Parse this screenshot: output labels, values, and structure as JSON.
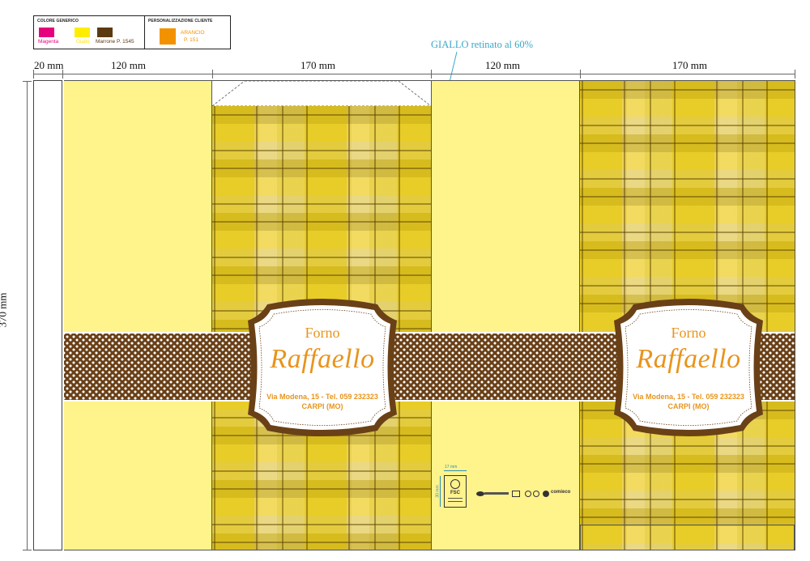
{
  "legend": {
    "generic_title": "COLORE GENERICO",
    "custom_title": "PERSONALIZZAZIONE CLIENTE",
    "swatches": [
      {
        "label": "Magenta",
        "color": "#e6007e"
      },
      {
        "label": "Giallo",
        "color": "#ffed00"
      },
      {
        "label": "Marrone P. 1545",
        "color": "#5c3a10"
      }
    ],
    "custom": {
      "label_line1": "ARANCIO",
      "label_line2": "P. 151",
      "color": "#f39200"
    }
  },
  "dimensions": {
    "w1": "20 mm",
    "w2": "120 mm",
    "w3": "170 mm",
    "w4": "120 mm",
    "w5": "170 mm",
    "height": "370 mm"
  },
  "annotation": {
    "text": "GIALLO retinato al 60%",
    "color": "#3aa7c9"
  },
  "label": {
    "line1": "Forno",
    "line2": "Raffaello",
    "address": "Via Modena, 15 - Tel. 059 232323",
    "city": "CARPI (MO)",
    "text_color": "#e8941c",
    "frame_color": "#6a4017"
  },
  "certification": {
    "width_dim": "17 mm",
    "height_dim": "30 mm",
    "fsc": "FSC",
    "brand": "comieco"
  },
  "colors": {
    "yellow": "#fff38c",
    "brown": "#6a4017"
  }
}
